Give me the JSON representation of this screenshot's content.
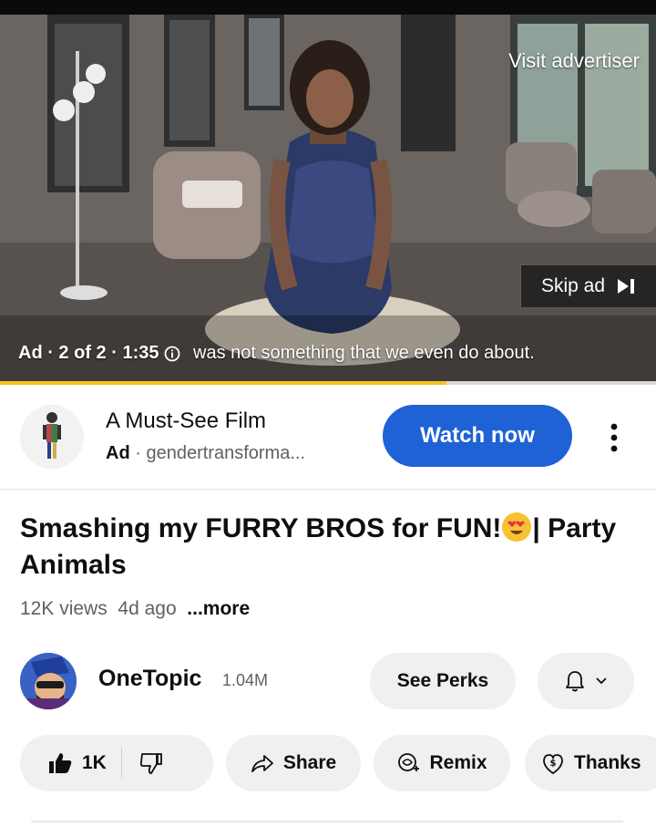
{
  "player": {
    "visit_advertiser": "Visit advertiser",
    "skip_ad": "Skip ad",
    "ad_status": "Ad · 2 of 2 · 1:35",
    "caption": "was not something that we even do about.",
    "progress_fraction": 0.68,
    "progress_color": "#f6c21b"
  },
  "ad": {
    "title": "A Must-See Film",
    "badge": "Ad",
    "separator": "·",
    "domain": "gendertransforma...",
    "cta": "Watch now",
    "cta_color": "#1f62d6",
    "more_icon": "more-vertical-icon"
  },
  "video": {
    "title": "Smashing my FURRY BROS for FUN!",
    "title_suffix": "| Party Animals",
    "emoji": "heart-eyes-emoji",
    "views": "12K views",
    "age": "4d ago",
    "more": "...more"
  },
  "channel": {
    "name": "OneTopic",
    "subscribers": "1.04M",
    "see_perks": "See Perks",
    "bell_icon": "bell-icon"
  },
  "actions": {
    "likes": "1K",
    "share": "Share",
    "remix": "Remix",
    "thanks": "Thanks"
  }
}
